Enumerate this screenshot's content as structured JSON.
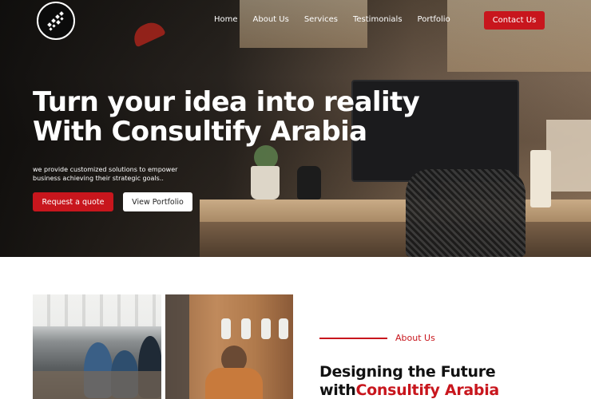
{
  "nav": {
    "links": [
      "Home",
      "About Us",
      "Services",
      "Testimonials",
      "Portfolio"
    ],
    "contact_label": "Contact Us"
  },
  "hero": {
    "title_line1": "Turn your idea into reality",
    "title_line2": "With Consultify Arabia",
    "subtitle": "we provide customized solutions to empower business achieving their strategic goals..",
    "primary_button": "Request a quote",
    "secondary_button": "View Portfolio"
  },
  "about": {
    "label": "About Us",
    "heading_line1": "Designing the Future",
    "heading_line2_prefix": "with",
    "heading_line2_brand": "Consultify Arabia"
  },
  "colors": {
    "accent": "#c8161d",
    "text_dark": "#111111",
    "hero_overlay": "#0b0b0b"
  },
  "icons": {
    "logo": "consultify-logo-icon"
  }
}
